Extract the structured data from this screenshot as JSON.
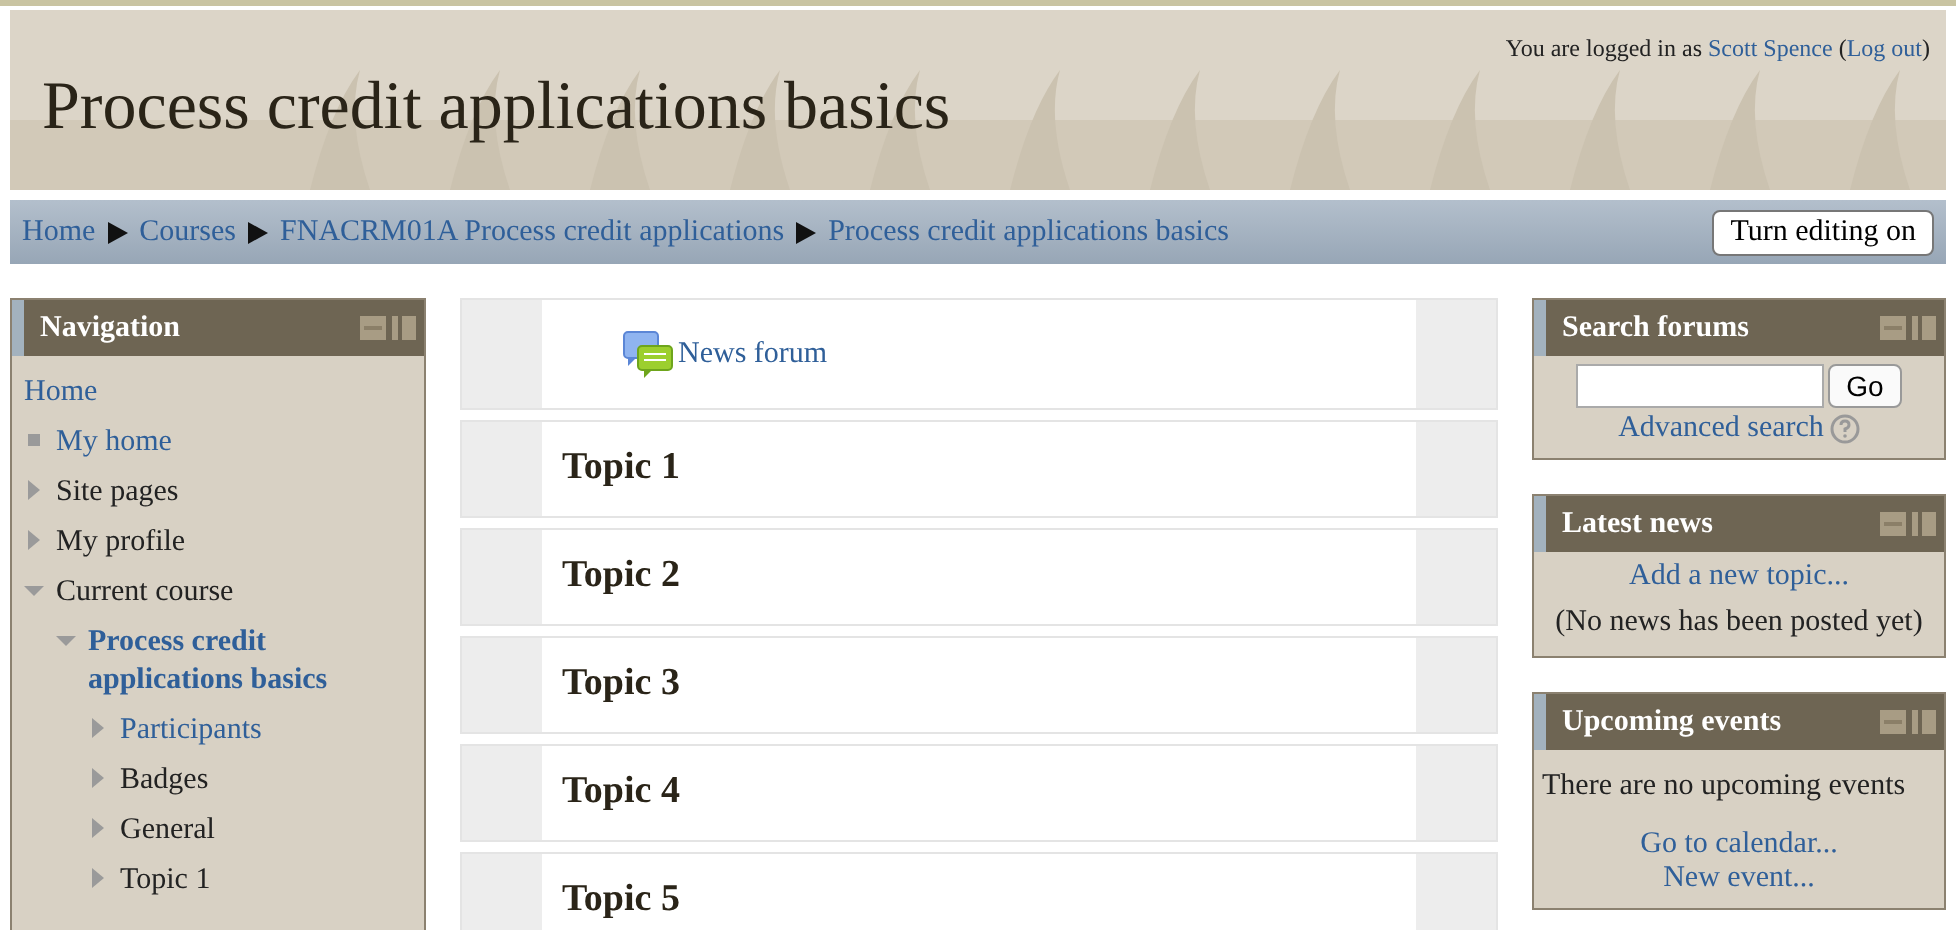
{
  "header": {
    "title": "Process credit applications basics",
    "login_prefix": "You are logged in as",
    "user": "Scott Spence",
    "open": "(",
    "logout": "Log out",
    "close": ")"
  },
  "breadcrumb": [
    "Home",
    "Courses",
    "FNACRM01A Process credit applications",
    "Process credit applications basics"
  ],
  "editing_button": "Turn editing on",
  "navigation": {
    "title": "Navigation",
    "items": [
      {
        "label": "Home",
        "kind": "root",
        "link": true
      },
      {
        "label": "My home",
        "kind": "leaf",
        "link": true
      },
      {
        "label": "Site pages",
        "kind": "branch",
        "link": false,
        "expanded": false
      },
      {
        "label": "My profile",
        "kind": "branch",
        "link": false,
        "expanded": false
      },
      {
        "label": "Current course",
        "kind": "branch",
        "link": false,
        "expanded": true,
        "children": [
          {
            "label": "Process credit applications basics",
            "kind": "branch",
            "link": true,
            "current": true,
            "expanded": true,
            "children": [
              {
                "label": "Participants",
                "kind": "branch",
                "link": true,
                "expanded": false
              },
              {
                "label": "Badges",
                "kind": "branch",
                "link": false,
                "expanded": false
              },
              {
                "label": "General",
                "kind": "branch",
                "link": false,
                "expanded": false
              },
              {
                "label": "Topic 1",
                "kind": "branch",
                "link": false,
                "expanded": false
              }
            ]
          }
        ]
      }
    ]
  },
  "sections": [
    {
      "kind": "activity",
      "label": "News forum"
    },
    {
      "kind": "topic",
      "label": "Topic 1"
    },
    {
      "kind": "topic",
      "label": "Topic 2"
    },
    {
      "kind": "topic",
      "label": "Topic 3"
    },
    {
      "kind": "topic",
      "label": "Topic 4"
    },
    {
      "kind": "topic",
      "label": "Topic 5"
    }
  ],
  "blocks": [
    {
      "kind": "search",
      "title": "Search forums",
      "button": "Go",
      "link": "Advanced search"
    },
    {
      "kind": "news",
      "title": "Latest news",
      "link": "Add a new topic...",
      "note": "(No news has been posted yet)"
    },
    {
      "kind": "events",
      "title": "Upcoming events",
      "note": "There are no upcoming events",
      "links": [
        "Go to calendar...",
        "New event..."
      ]
    }
  ]
}
